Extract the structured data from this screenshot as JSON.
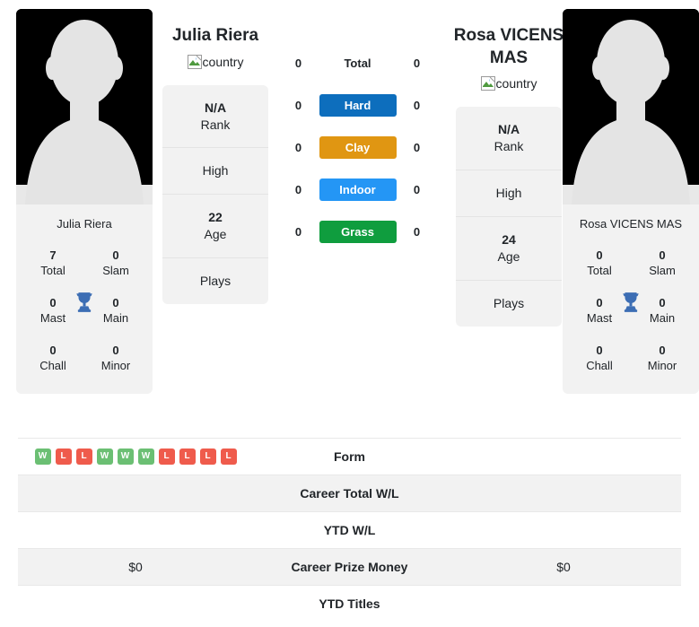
{
  "players": {
    "left": {
      "name": "Julia Riera",
      "photo_name": "Julia Riera",
      "country_alt": "country",
      "stats": [
        {
          "num": "7",
          "label": "Total"
        },
        {
          "num": "0",
          "label": "Slam"
        },
        {
          "num": "0",
          "label": "Mast"
        },
        {
          "num": "0",
          "label": "Main"
        },
        {
          "num": "0",
          "label": "Chall"
        },
        {
          "num": "0",
          "label": "Minor"
        }
      ],
      "info": [
        {
          "value": "N/A",
          "sub": "Rank"
        },
        {
          "plain": "High"
        },
        {
          "value": "22",
          "sub": "Age"
        },
        {
          "plain": "Plays"
        }
      ]
    },
    "right": {
      "name": "Rosa VICENS MAS",
      "photo_name": "Rosa VICENS MAS",
      "country_alt": "country",
      "stats": [
        {
          "num": "0",
          "label": "Total"
        },
        {
          "num": "0",
          "label": "Slam"
        },
        {
          "num": "0",
          "label": "Mast"
        },
        {
          "num": "0",
          "label": "Main"
        },
        {
          "num": "0",
          "label": "Chall"
        },
        {
          "num": "0",
          "label": "Minor"
        }
      ],
      "info": [
        {
          "value": "N/A",
          "sub": "Rank"
        },
        {
          "plain": "High"
        },
        {
          "value": "24",
          "sub": "Age"
        },
        {
          "plain": "Plays"
        }
      ]
    }
  },
  "surfaces": [
    {
      "label": "Total",
      "left": "0",
      "right": "0",
      "color": "none",
      "plain": true
    },
    {
      "label": "Hard",
      "left": "0",
      "right": "0",
      "color": "#0d6ebd",
      "plain": false
    },
    {
      "label": "Clay",
      "left": "0",
      "right": "0",
      "color": "#e09612",
      "plain": false
    },
    {
      "label": "Indoor",
      "left": "0",
      "right": "0",
      "color": "#2496f5",
      "plain": false
    },
    {
      "label": "Grass",
      "left": "0",
      "right": "0",
      "color": "#0f9d3e",
      "plain": false
    }
  ],
  "comparison_rows": [
    {
      "label": "Form",
      "left": "",
      "right": "",
      "shaded": false,
      "type": "form"
    },
    {
      "label": "Career Total W/L",
      "left": "",
      "right": "",
      "shaded": true,
      "type": "text"
    },
    {
      "label": "YTD W/L",
      "left": "",
      "right": "",
      "shaded": false,
      "type": "text"
    },
    {
      "label": "Career Prize Money",
      "left": "$0",
      "right": "$0",
      "shaded": true,
      "type": "text"
    },
    {
      "label": "YTD Titles",
      "left": "",
      "right": "",
      "shaded": false,
      "type": "text"
    }
  ],
  "form": {
    "left_results": [
      "W",
      "L",
      "L",
      "W",
      "W",
      "W",
      "L",
      "L",
      "L",
      "L"
    ],
    "right_results": []
  },
  "colors": {
    "win": "#6bbf73",
    "loss": "#ef5b4c",
    "trophy": "#3d6eb4",
    "card_bg": "#f2f2f2",
    "photo_bg": "#000000",
    "silhouette": "#e4e4e4"
  }
}
